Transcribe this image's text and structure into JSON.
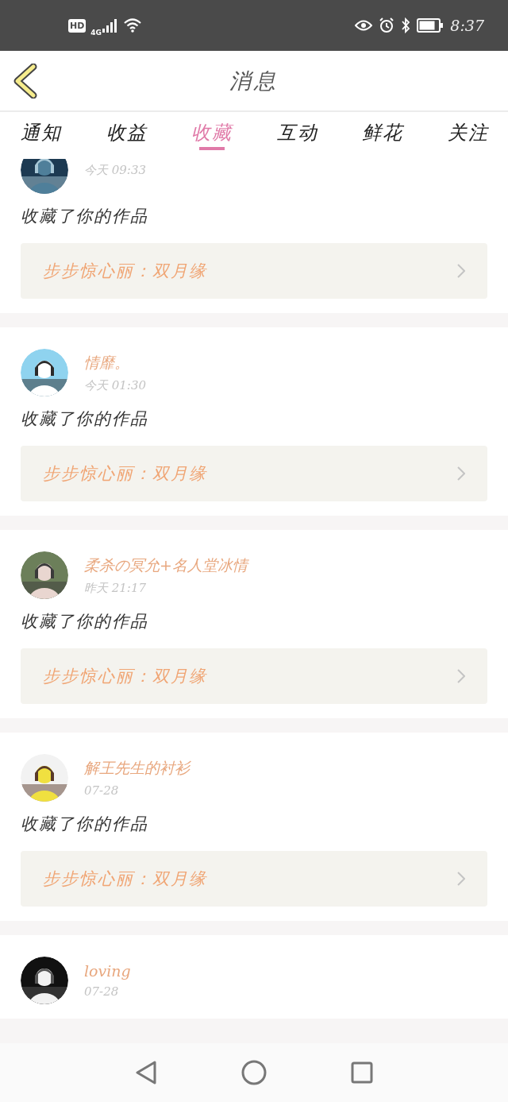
{
  "status_bar": {
    "hd_badge": "HD",
    "network": "4G",
    "time": "8:37"
  },
  "header": {
    "title": "消息"
  },
  "tabs": [
    {
      "label": "通知",
      "selected": false
    },
    {
      "label": "收益",
      "selected": false
    },
    {
      "label": "收藏",
      "selected": true
    },
    {
      "label": "互动",
      "selected": false
    },
    {
      "label": "鲜花",
      "selected": false
    },
    {
      "label": "关注",
      "selected": false
    }
  ],
  "messages": [
    {
      "time": "今天 09:33",
      "action": "收藏了你的作品",
      "work": "步步惊心丽：双月缘"
    },
    {
      "name": "情靡。",
      "time": "今天 01:30",
      "action": "收藏了你的作品",
      "work": "步步惊心丽：双月缘"
    },
    {
      "name": "柔杀の冥允+名人堂冰情",
      "time": "昨天 21:17",
      "action": "收藏了你的作品",
      "work": "步步惊心丽：双月缘"
    },
    {
      "name": "解王先生的衬衫",
      "time": "07-28",
      "action": "收藏了你的作品",
      "work": "步步惊心丽：双月缘"
    },
    {
      "name": "loving",
      "time": "07-28"
    }
  ]
}
